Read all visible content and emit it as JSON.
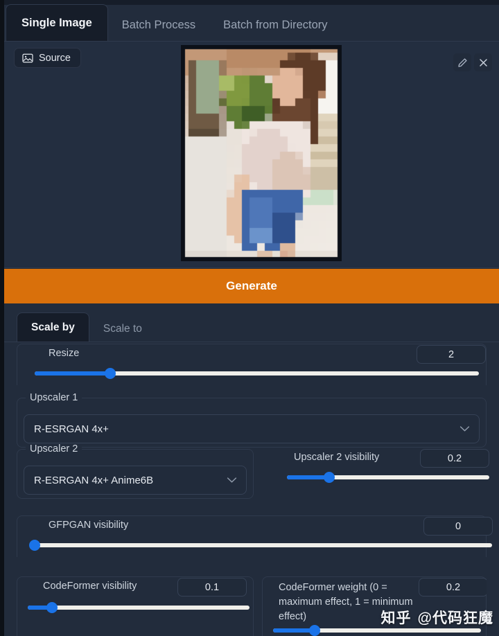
{
  "window": {
    "background_color": "#1f2937",
    "accent_color": "#d9700b",
    "slider_color": "#1a73e8"
  },
  "top_tabs": [
    {
      "label": "Single Image",
      "active": true
    },
    {
      "label": "Batch Process",
      "active": false
    },
    {
      "label": "Batch from Directory",
      "active": false
    }
  ],
  "image_panel": {
    "source_chip_label": "Source",
    "source_icon": "image-icon",
    "edit_icon": "pencil-icon",
    "close_icon": "close-x-icon",
    "preview_alt": "pixelated photo preview"
  },
  "generate": {
    "label": "Generate"
  },
  "scale_tabs": [
    {
      "label": "Scale by",
      "active": true
    },
    {
      "label": "Scale to",
      "active": false
    }
  ],
  "controls": {
    "resize": {
      "label": "Resize",
      "value": "2",
      "slider_percent": 17
    },
    "upscaler_1": {
      "legend": "Upscaler 1",
      "selected": "R-ESRGAN 4x+",
      "chevron_icon": "chevron-down-icon"
    },
    "upscaler_2": {
      "legend": "Upscaler 2",
      "selected": "R-ESRGAN 4x+ Anime6B",
      "chevron_icon": "chevron-down-icon"
    },
    "upscaler_2_visibility": {
      "label": "Upscaler 2 visibility",
      "value": "0.2",
      "slider_percent": 21
    },
    "gfpgan_visibility": {
      "label": "GFPGAN visibility",
      "value": "0",
      "slider_percent": 0
    },
    "codeformer_visibility": {
      "label": "CodeFormer visibility",
      "value": "0.1",
      "slider_percent": 11
    },
    "codeformer_weight": {
      "label": "CodeFormer weight (0 = maximum effect, 1 = minimum effect)",
      "value": "0.2",
      "slider_percent": 20
    }
  },
  "watermark": {
    "site": "知乎",
    "handle": "@代码狂魔"
  }
}
